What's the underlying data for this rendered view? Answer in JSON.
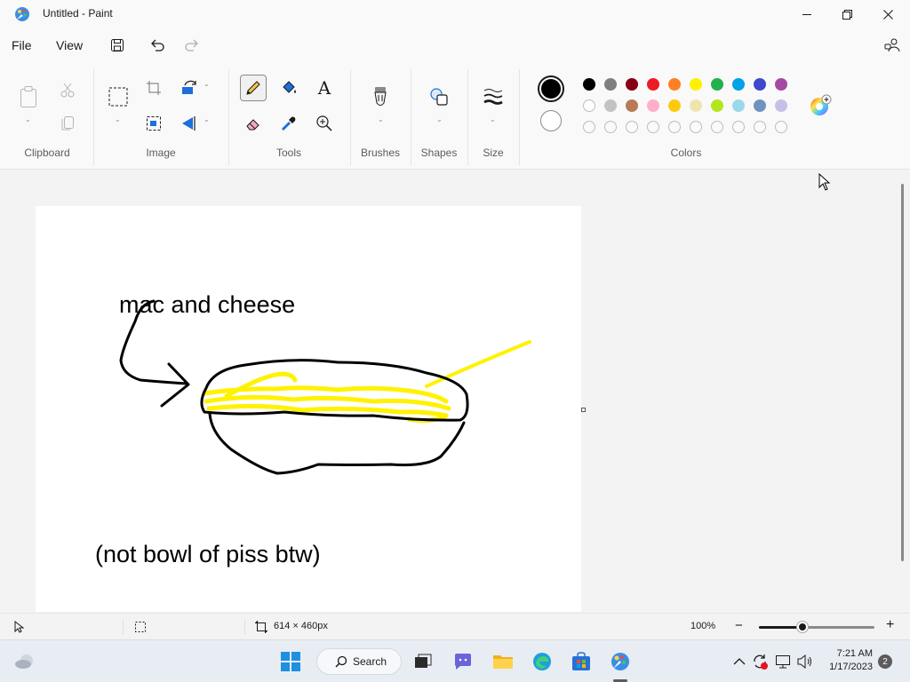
{
  "window": {
    "title": "Untitled - Paint"
  },
  "menu": {
    "file": "File",
    "view": "View"
  },
  "ribbon": {
    "groups": {
      "clipboard": "Clipboard",
      "image": "Image",
      "tools": "Tools",
      "brushes": "Brushes",
      "shapes": "Shapes",
      "size": "Size",
      "colors": "Colors"
    },
    "text_tool_glyph": "A"
  },
  "palette": {
    "row1": [
      "#000000",
      "#7f7f7f",
      "#880015",
      "#ed1c24",
      "#ff7f27",
      "#fff200",
      "#22b14c",
      "#00a2e8",
      "#3f48cc",
      "#a349a4"
    ],
    "row2": [
      "#ffffff",
      "#c3c3c3",
      "#b97a57",
      "#ffaec9",
      "#ffc90e",
      "#efe4b0",
      "#b5e61d",
      "#99d9ea",
      "#7092be",
      "#c8bfe7"
    ],
    "row3_empty_count": 10,
    "primary": "#000000",
    "secondary": "#ffffff"
  },
  "canvas": {
    "text1": "mac and cheese",
    "text2": "(not bowl of piss btw)",
    "stroke_colors": {
      "outline": "#000000",
      "cheese": "#fff200"
    }
  },
  "status": {
    "canvas_size": "614 × 460px",
    "zoom": "100%",
    "zoom_level_fraction": 0.38,
    "zoom_minus": "−",
    "zoom_plus": "+"
  },
  "taskbar": {
    "search_label": "Search",
    "time": "7:21 AM",
    "date": "1/17/2023",
    "notification_count": "2"
  }
}
